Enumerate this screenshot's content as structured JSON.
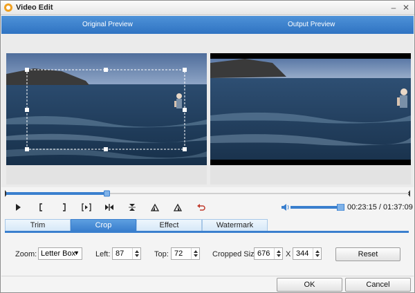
{
  "window": {
    "title": "Video Edit"
  },
  "header": {
    "original_preview": "Original Preview",
    "output_preview": "Output Preview"
  },
  "playback": {
    "current_time": "00:23:15",
    "separator": " / ",
    "total_time": "01:37:09",
    "progress": 0.25,
    "volume": 0.93
  },
  "tabs": [
    {
      "label": "Trim"
    },
    {
      "label": "Crop"
    },
    {
      "label": "Effect"
    },
    {
      "label": "Watermark"
    }
  ],
  "crop": {
    "zoom_label": "Zoom:",
    "zoom_value": "Letter Box",
    "left_label": "Left:",
    "left_value": "87",
    "top_label": "Top:",
    "top_value": "72",
    "size_label": "Cropped Size:",
    "width_value": "676",
    "x_label": "X",
    "height_value": "344",
    "reset_label": "Reset"
  },
  "footer": {
    "ok_label": "OK",
    "cancel_label": "Cancel"
  },
  "colors": {
    "accent": "#3a7fce",
    "header": "#2f73c2",
    "sea": "#2c4d6f",
    "sky": "#5f7eaa"
  }
}
